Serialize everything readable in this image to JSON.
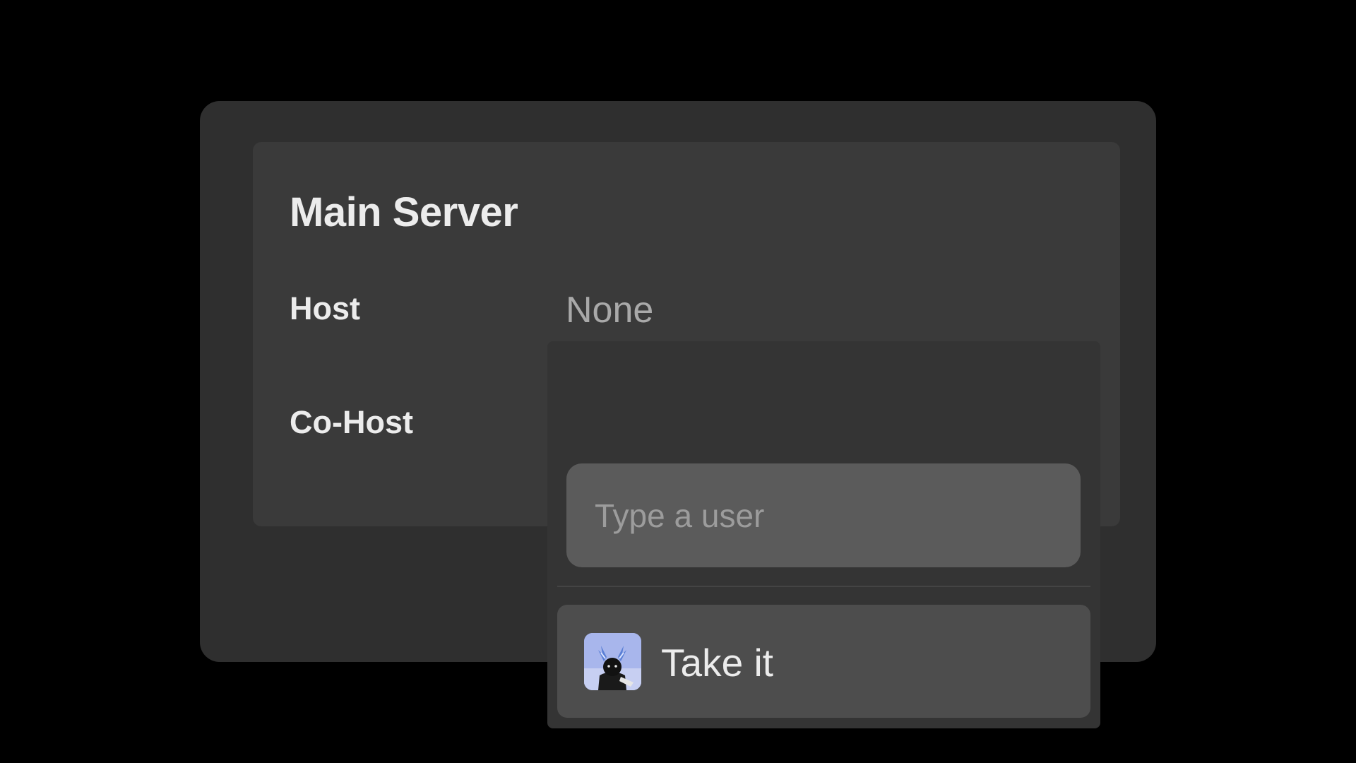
{
  "server": {
    "title": "Main Server",
    "host_label": "Host",
    "host_value": "None",
    "cohost_label": "Co-Host"
  },
  "user_picker": {
    "placeholder": "Type a user",
    "value": "",
    "options": [
      {
        "label": "Take it",
        "avatar_icon": "user-avatar-icon"
      }
    ]
  },
  "colors": {
    "page_background": "#000000",
    "panel": "#2f2f2f",
    "card": "#3a3a3a",
    "input": "#5b5b5b",
    "option": "#4d4d4d",
    "text_primary": "#ececec",
    "text_muted": "#a9a9a9"
  }
}
